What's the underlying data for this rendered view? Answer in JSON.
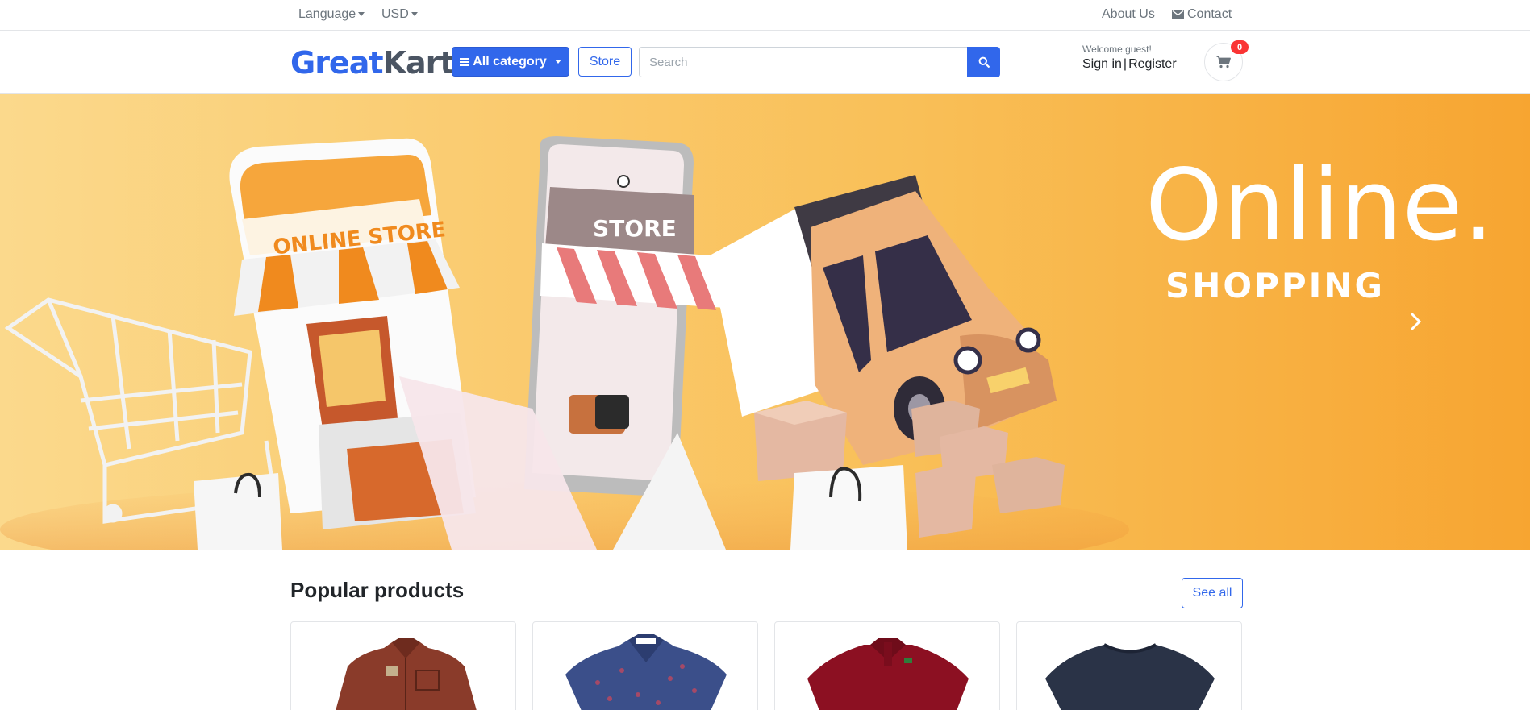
{
  "topbar": {
    "language_label": "Language",
    "currency_label": "USD",
    "about_label": "About Us",
    "contact_label": "Contact"
  },
  "header": {
    "logo_part1": "Great",
    "logo_part2": "Kart",
    "category_label": "All category",
    "store_label": "Store",
    "search_placeholder": "Search",
    "welcome_text": "Welcome guest!",
    "signin_label": "Sign in",
    "register_label": "Register",
    "cart_count": "0"
  },
  "banner": {
    "headline": "Online.",
    "subline": "SHOPPING",
    "sign_online_store": "ONLINE STORE",
    "sign_store": "STORE"
  },
  "popular": {
    "title": "Popular products",
    "see_all_label": "See all",
    "products": [
      {
        "name": "rust-button-shirt",
        "color": "#8a3b2a"
      },
      {
        "name": "navy-print-shirt",
        "color": "#3b4f8a"
      },
      {
        "name": "maroon-polo",
        "color": "#8c1022"
      },
      {
        "name": "navy-tshirt",
        "color": "#2a3347"
      }
    ]
  },
  "colors": {
    "primary": "#3167eb",
    "badge": "#fa3434",
    "banner_start": "#fad98b",
    "banner_end": "#f7a531"
  }
}
